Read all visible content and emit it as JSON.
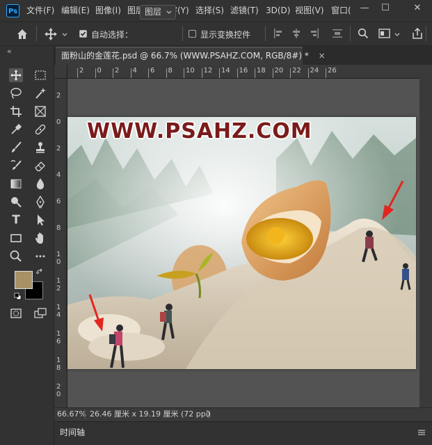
{
  "app": {
    "logo": "Ps"
  },
  "menu": {
    "items": [
      "文件(F)",
      "编辑(E)",
      "图像(I)",
      "图层(L)",
      "文字(Y)",
      "选择(S)",
      "滤镜(T)",
      "3D(D)",
      "视图(V)",
      "窗口("
    ]
  },
  "window_controls": {
    "minimize": "—",
    "restore": "☐",
    "close": "✕"
  },
  "options": {
    "auto_select_label": "自动选择：",
    "auto_select_checked": true,
    "layer_select_value": "图层",
    "show_transform_label": "显示变换控件",
    "show_transform_checked": false
  },
  "toolbar": {
    "collapse": "«",
    "tools": [
      "move",
      "marquee",
      "lasso",
      "quick-select",
      "crop",
      "frame",
      "eyedropper",
      "healing",
      "brush",
      "stamp",
      "history-brush",
      "eraser",
      "gradient",
      "blur",
      "dodge",
      "pen",
      "type",
      "path-select",
      "rectangle",
      "hand",
      "zoom",
      "more"
    ],
    "foreground_color": "#a89265",
    "background_color": "#000000"
  },
  "document": {
    "tab_title": "面粉山的金莲花.psd @ 66.7% (WWW.PSAHZ.COM, RGB/8#) *",
    "tab_close": "×",
    "watermark": "WWW.PSAHZ.COM"
  },
  "rulers": {
    "top_labels": [
      "2",
      "0",
      "2",
      "4",
      "6",
      "8",
      "10",
      "12",
      "14",
      "16",
      "18",
      "20",
      "22",
      "24",
      "26"
    ],
    "left_labels": [
      "2",
      "0",
      "2",
      "4",
      "6",
      "8",
      "1\n0",
      "1\n2",
      "1\n4",
      "1\n6",
      "1\n8",
      "2\n0"
    ]
  },
  "status": {
    "zoom": "66.67%",
    "doc_info": "26.46 厘米 x 19.19 厘米 (72 ppi)",
    "arrow": "〉"
  },
  "timeline": {
    "label": "时间轴"
  }
}
